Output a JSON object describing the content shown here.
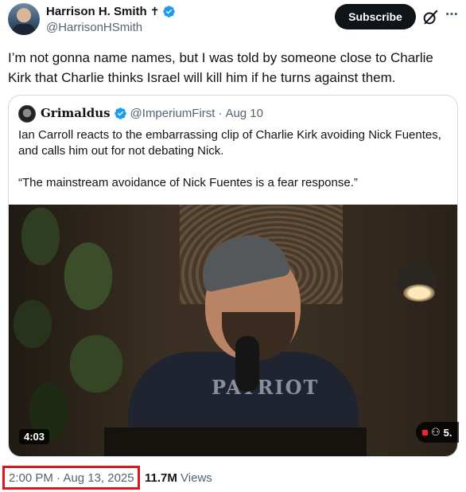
{
  "author": {
    "display_name": "Harrison H. Smith",
    "name_glyph": "✝",
    "handle": "@HarrisonHSmith"
  },
  "actions": {
    "subscribe_label": "Subscribe"
  },
  "tweet": {
    "text": "I’m not gonna name names, but I was told by someone close to Charlie Kirk that Charlie thinks Israel will kill him if he turns against them."
  },
  "quote": {
    "display_name": "Grimaldus",
    "handle": "@ImperiumFirst",
    "separator": "·",
    "date": "Aug 10",
    "paragraph_1": "Ian Carroll reacts to the embarrassing clip of Charlie Kirk avoiding Nick Fuentes, and calls him out for not debating Nick.",
    "paragraph_2": "“The mainstream avoidance of Nick Fuentes is a fear response.”",
    "video": {
      "duration": "4:03",
      "viewers_badge": "5.",
      "shirt_text": "PATRIOT"
    }
  },
  "meta": {
    "timestamp": "2:00 PM · Aug 13, 2025",
    "views_count": "11.7M",
    "views_label": "Views"
  },
  "colors": {
    "text_primary": "#0f1419",
    "text_secondary": "#536471",
    "verified_blue": "#1d9bf0",
    "highlight_red": "#e0141e"
  }
}
